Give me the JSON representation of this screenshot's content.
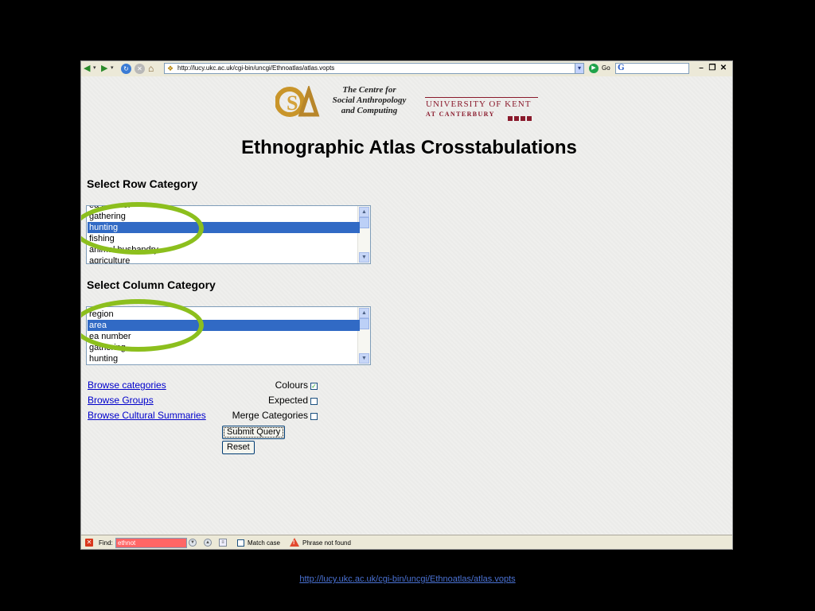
{
  "browser": {
    "url": "http://lucy.ukc.ac.uk/cgi-bin/uncgi/Ethnoatlas/atlas.vopts",
    "go_label": "Go",
    "search_logo": "G"
  },
  "header": {
    "centre_line1": "The Centre for",
    "centre_line2": "Social Anthropology",
    "centre_line3": "and Computing",
    "university": "UNIVERSITY OF KENT",
    "university_sub": "AT CANTERBURY",
    "logo_letters": "CSA"
  },
  "page": {
    "title": "Ethnographic Atlas Crosstabulations",
    "row_section": "Select Row Category",
    "column_section": "Select Column Category"
  },
  "row_list": {
    "items": [
      "ea number",
      "gathering",
      "hunting",
      "fishing",
      "animal husbandry",
      "agriculture"
    ],
    "selected": "hunting"
  },
  "column_list": {
    "items": [
      "region",
      "area",
      "ea number",
      "gathering",
      "hunting"
    ],
    "selected": "area"
  },
  "links": {
    "browse_categories": "Browse categories",
    "browse_groups": "Browse Groups",
    "browse_cultural": "Browse Cultural Summaries"
  },
  "options": {
    "colours": "Colours",
    "colours_checked": true,
    "expected": "Expected",
    "expected_checked": false,
    "merge": "Merge Categories",
    "merge_checked": false
  },
  "buttons": {
    "submit": "Submit Query",
    "reset": "Reset"
  },
  "findbar": {
    "label": "Find:",
    "query": "ethnot",
    "match_case": "Match case",
    "status": "Phrase not found"
  },
  "caption": "http://lucy.ukc.ac.uk/cgi-bin/uncgi/Ethnoatlas/atlas.vopts",
  "colors": {
    "highlight_ring": "#8cbf1d",
    "selection": "#316ac5",
    "kent_red": "#8a1a2c",
    "find_error": "#ff6666"
  }
}
